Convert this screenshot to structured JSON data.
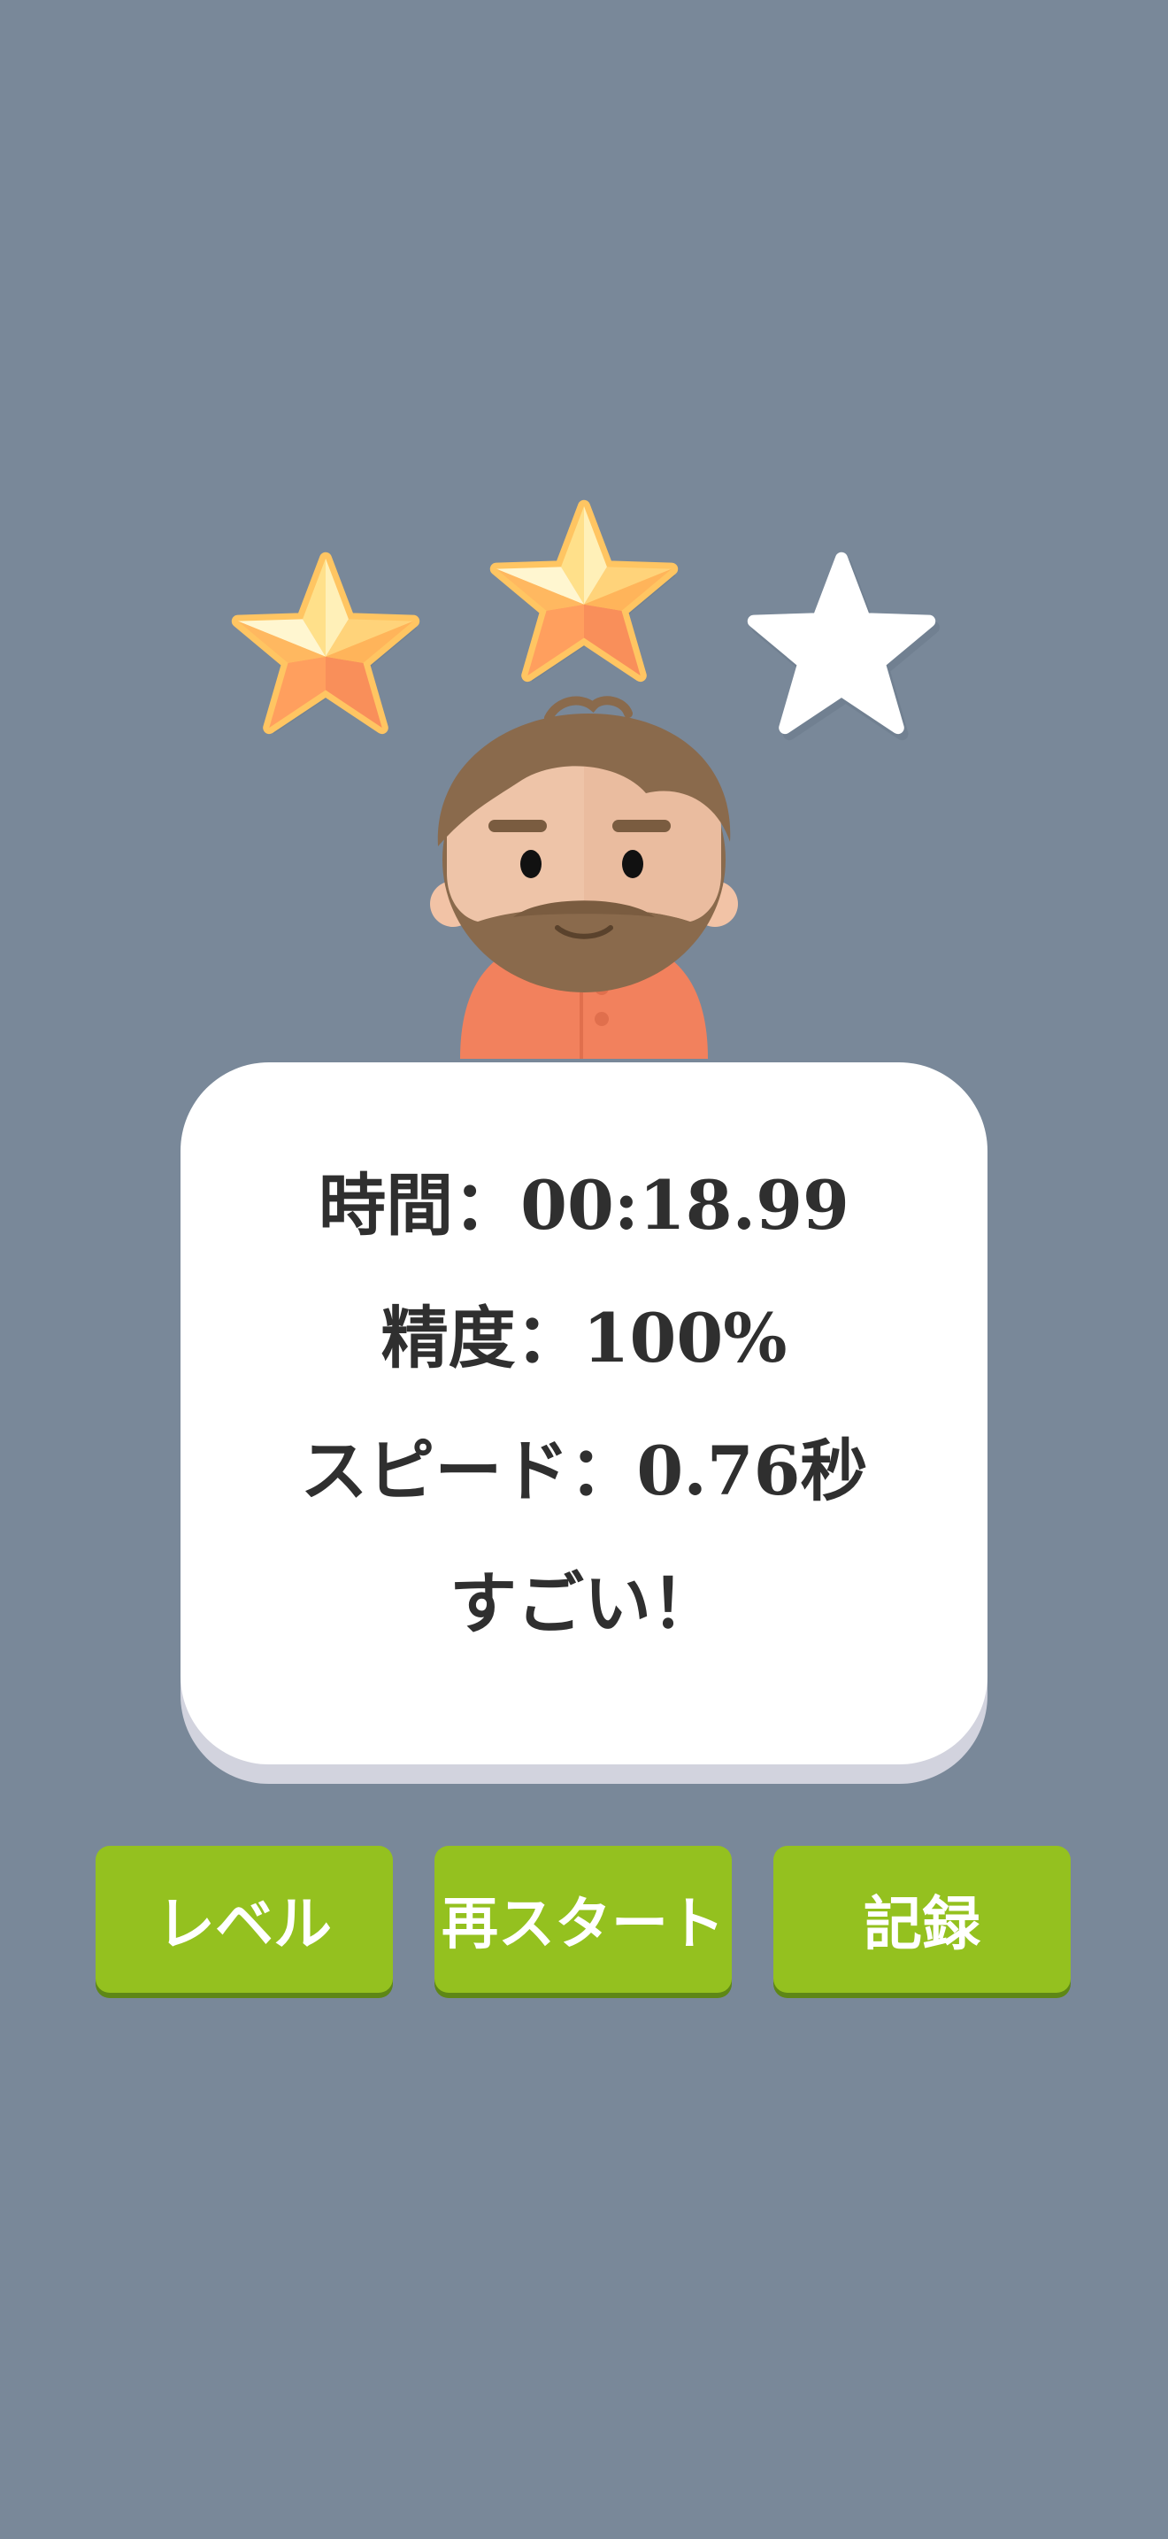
{
  "result": {
    "stars": {
      "earned": 2,
      "total": 3
    },
    "time_label": "時間：00:18.99",
    "accuracy_label": "精度：100%",
    "speed_label": "スピード：0.76秒",
    "praise": "すごい！"
  },
  "buttons": {
    "level": "レベル",
    "restart": "再スタート",
    "records": "記録"
  },
  "colors": {
    "background": "#798899",
    "button": "#94c11f",
    "card": "#ffffff",
    "star_gold": "#ffc562",
    "star_empty": "#ffffff",
    "shirt": "#f2815d",
    "hair_beard": "#8a6a4c"
  },
  "icons": [
    "star-filled-icon",
    "star-filled-icon",
    "star-empty-icon",
    "avatar-bearded-man"
  ]
}
